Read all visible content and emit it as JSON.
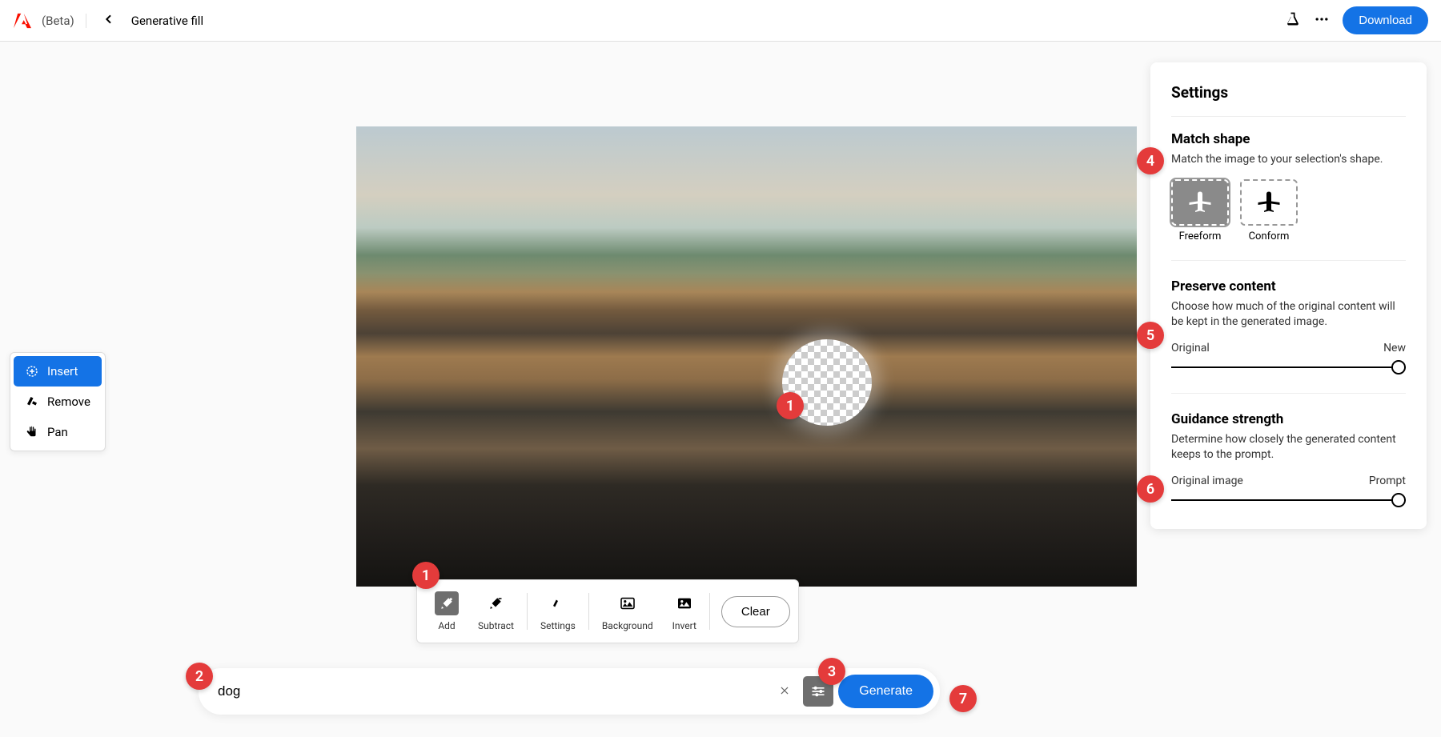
{
  "header": {
    "beta": "(Beta)",
    "page_title": "Generative fill",
    "download": "Download"
  },
  "left_toolbar": {
    "insert": "Insert",
    "remove": "Remove",
    "pan": "Pan"
  },
  "bottom_toolbar": {
    "add": "Add",
    "subtract": "Subtract",
    "settings": "Settings",
    "background": "Background",
    "invert": "Invert",
    "clear": "Clear"
  },
  "prompt": {
    "value": "dog",
    "generate": "Generate"
  },
  "settings_panel": {
    "title": "Settings",
    "match_shape": {
      "title": "Match shape",
      "desc": "Match the image to your selection's shape.",
      "freeform": "Freeform",
      "conform": "Conform"
    },
    "preserve": {
      "title": "Preserve content",
      "desc": "Choose how much of the original content will be kept in the generated image.",
      "left": "Original",
      "right": "New"
    },
    "guidance": {
      "title": "Guidance strength",
      "desc": "Determine how closely the generated content keeps to the prompt.",
      "left": "Original image",
      "right": "Prompt"
    }
  },
  "callouts": {
    "c1a": "1",
    "c1b": "1",
    "c2": "2",
    "c3": "3",
    "c4": "4",
    "c5": "5",
    "c6": "6",
    "c7": "7"
  }
}
